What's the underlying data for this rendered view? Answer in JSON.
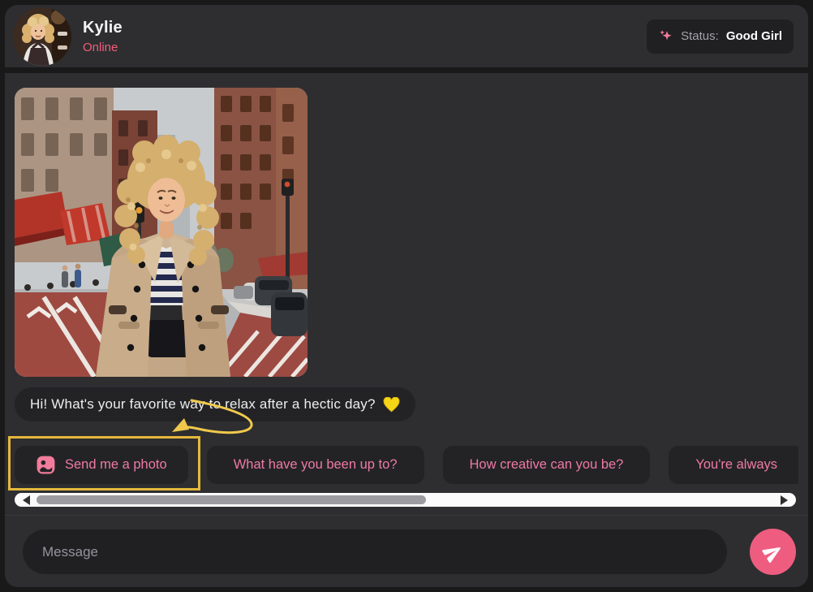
{
  "header": {
    "name": "Kylie",
    "presence": "Online",
    "status": {
      "label": "Status:",
      "value": "Good Girl",
      "icon": "sparkles-icon"
    }
  },
  "conversation": {
    "photo_description": "Woman with curly blonde hair wearing a beige double-breasted trench coat over a navy striped top, standing on a city street with red awnings, brick buildings and parked cars",
    "message": {
      "text": "Hi! What's your favorite way to relax after a hectic day?",
      "emoji": "💛"
    }
  },
  "suggestions": [
    {
      "label": "Send me a photo",
      "icon": "photo-icon",
      "highlighted": true
    },
    {
      "label": "What have you been up to?"
    },
    {
      "label": "How creative can you be?"
    },
    {
      "label": "You're always"
    }
  ],
  "composer": {
    "placeholder": "Message",
    "send_icon": "paper-plane-icon"
  },
  "annotation": {
    "type": "tutorial-arrow-and-box",
    "target": "Send me a photo",
    "color": "#e4b83c"
  },
  "colors": {
    "background": "#19191a",
    "panel": "#2e2e30",
    "bubble": "#232326",
    "presence_pink": "#ef5f7c",
    "chip_text_pink": "#ef7aa2",
    "send_pink": "#ee5d80",
    "highlight_yellow": "#e4b83c",
    "heart_yellow": "#f5d515",
    "scroll_track": "#fafafa",
    "scroll_thumb": "#9b9ba0"
  }
}
